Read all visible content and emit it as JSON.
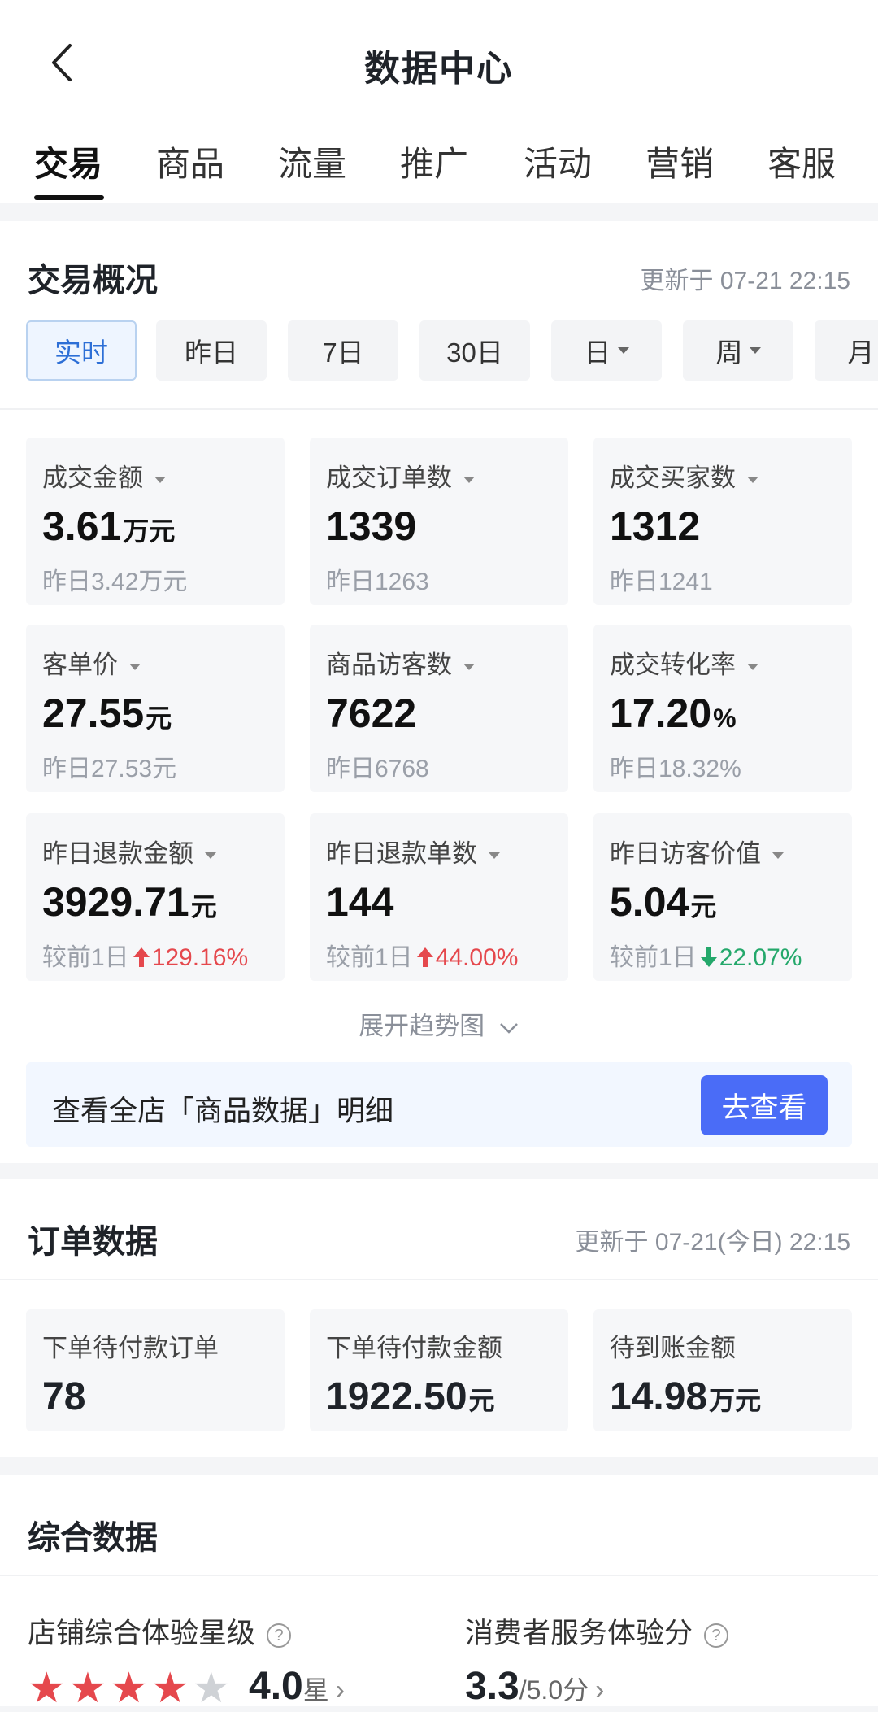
{
  "header": {
    "title": "数据中心"
  },
  "tabs": [
    {
      "label": "交易"
    },
    {
      "label": "商品"
    },
    {
      "label": "流量"
    },
    {
      "label": "推广"
    },
    {
      "label": "活动"
    },
    {
      "label": "营销"
    },
    {
      "label": "客服"
    }
  ],
  "overview": {
    "title": "交易概况",
    "updated": "更新于 07-21 22:15",
    "periods": [
      {
        "label": "实时"
      },
      {
        "label": "昨日"
      },
      {
        "label": "7日"
      },
      {
        "label": "30日"
      },
      {
        "label": "日"
      },
      {
        "label": "周"
      },
      {
        "label": "月"
      }
    ],
    "metrics": [
      {
        "label": "成交金额",
        "value": "3.61",
        "unit": "万元",
        "sub": "昨日3.42万元"
      },
      {
        "label": "成交订单数",
        "value": "1339",
        "unit": "",
        "sub": "昨日1263"
      },
      {
        "label": "成交买家数",
        "value": "1312",
        "unit": "",
        "sub": "昨日1241"
      },
      {
        "label": "客单价",
        "value": "27.55",
        "unit": "元",
        "sub": "昨日27.53元"
      },
      {
        "label": "商品访客数",
        "value": "7622",
        "unit": "",
        "sub": "昨日6768"
      },
      {
        "label": "成交转化率",
        "value": "17.20",
        "unit": "%",
        "sub": "昨日18.32%"
      },
      {
        "label": "昨日退款金额",
        "value": "3929.71",
        "unit": "元",
        "sub_prefix": "较前1日",
        "change": "129.16%",
        "direction": "up"
      },
      {
        "label": "昨日退款单数",
        "value": "144",
        "unit": "",
        "sub_prefix": "较前1日",
        "change": "44.00%",
        "direction": "up"
      },
      {
        "label": "昨日访客价值",
        "value": "5.04",
        "unit": "元",
        "sub_prefix": "较前1日",
        "change": "22.07%",
        "direction": "down"
      }
    ],
    "expand_label": "展开趋势图",
    "detail_text": "查看全店「商品数据」明细",
    "detail_button": "去查看"
  },
  "orders": {
    "title": "订单数据",
    "updated": "更新于 07-21(今日) 22:15",
    "items": [
      {
        "label": "下单待付款订单",
        "value": "78",
        "unit": ""
      },
      {
        "label": "下单待付款金额",
        "value": "1922.50",
        "unit": "元"
      },
      {
        "label": "待到账金额",
        "value": "14.98",
        "unit": "万元"
      }
    ]
  },
  "overall": {
    "title": "综合数据",
    "star_label": "店铺综合体验星级",
    "star_rating": 4,
    "star_max": 5,
    "star_value": "4.0",
    "star_unit": "星",
    "service_label": "消费者服务体验分",
    "service_value": "3.3",
    "service_max": "/5.0分"
  },
  "colors": {
    "accent": "#4a6cf7",
    "up": "#e5484d",
    "down": "#24a86b"
  }
}
